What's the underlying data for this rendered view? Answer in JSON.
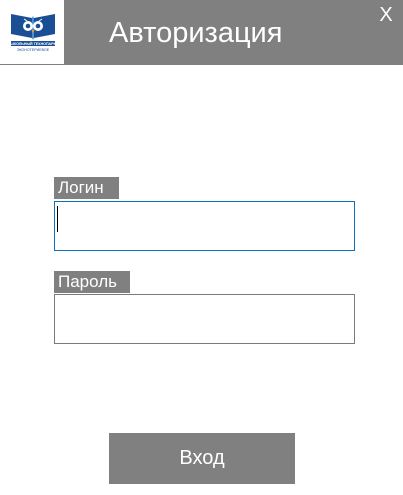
{
  "window": {
    "title": "Авторизация",
    "close_label": "X"
  },
  "logo": {
    "icon": "open-book-owl-logo",
    "text_line1": "ШКОЛЬНЫЙ ТЕХНОПАРК",
    "text_line2": "ЭКОНОТЕРИЕВОЕ",
    "colors": {
      "blue": "#1a4f95",
      "light_blue": "#4a8fd4",
      "accent": "#f0a020"
    }
  },
  "form": {
    "login_label": "Логин",
    "login_value": "",
    "password_label": "Пароль",
    "password_value": "",
    "submit_label": "Вход"
  },
  "colors": {
    "header_bg": "#808080",
    "focus_border": "#0e6fb8",
    "button_bg": "#808080"
  }
}
